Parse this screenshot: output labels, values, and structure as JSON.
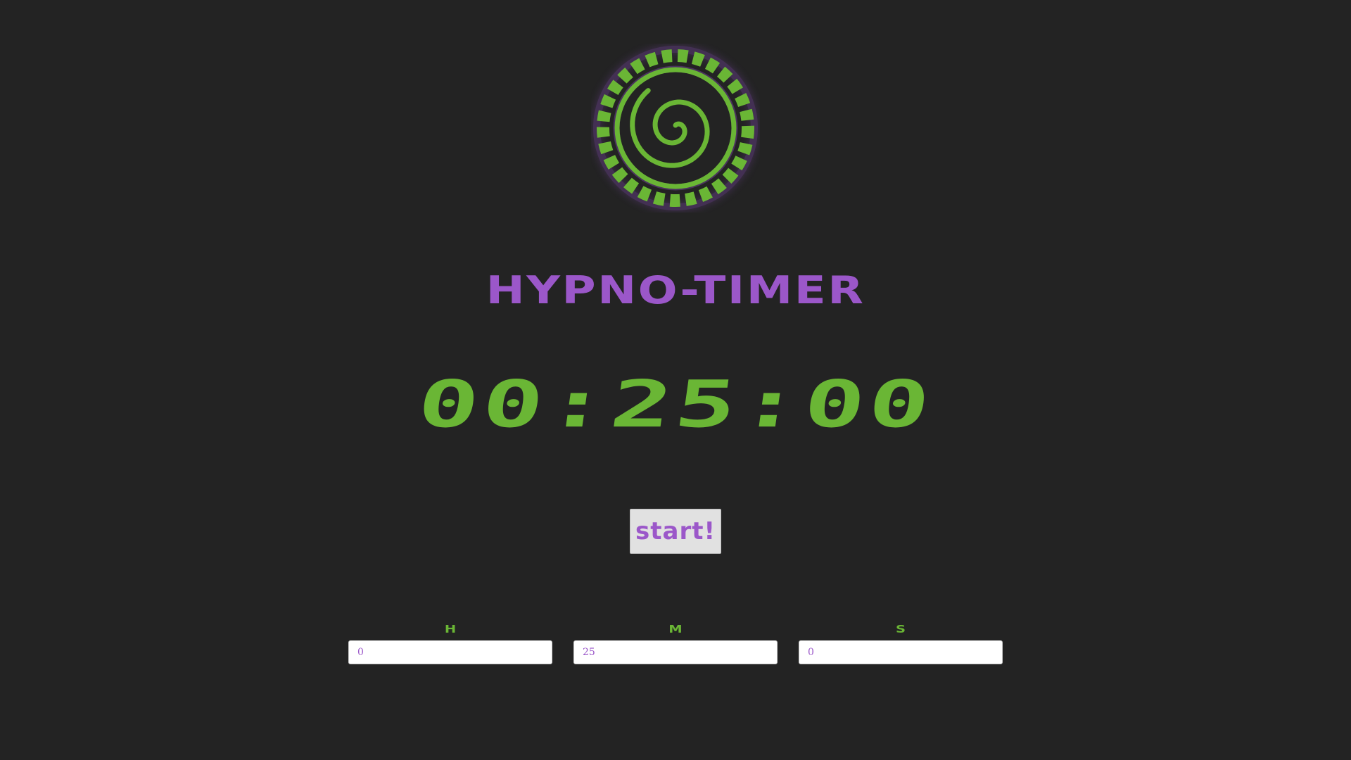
{
  "app": {
    "title": "HYPNO-TIMER"
  },
  "logo": {
    "icon": "hypno-spiral-icon"
  },
  "timer": {
    "display": "00:25:00"
  },
  "controls": {
    "start_label": "start!"
  },
  "inputs": {
    "hours": {
      "label": "H",
      "value": "0"
    },
    "minutes": {
      "label": "M",
      "value": "25"
    },
    "seconds": {
      "label": "S",
      "value": "0"
    }
  },
  "colors": {
    "background": "#232323",
    "accent_green": "#6ab635",
    "accent_purple": "#9b57c9",
    "button_bg": "#e1e1e1"
  }
}
